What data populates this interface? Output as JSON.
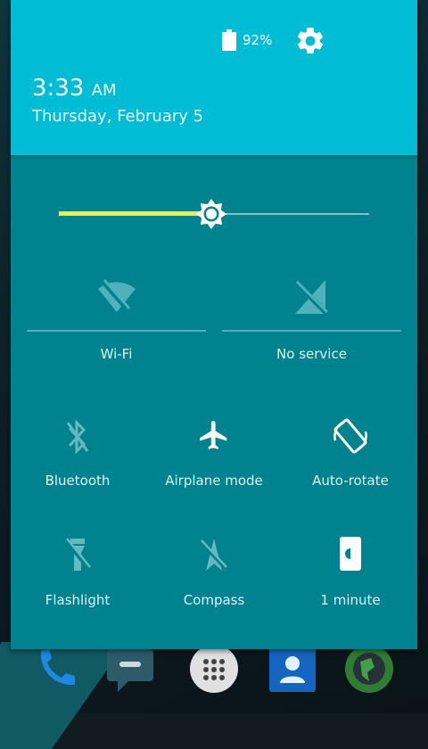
{
  "status": {
    "battery_percent": "92%",
    "battery_level": 0.92
  },
  "header": {
    "time": "3:33",
    "ampm": "AM",
    "date": "Thursday, February 5"
  },
  "brightness": {
    "level": 0.49
  },
  "tiles_top": [
    {
      "id": "wifi",
      "label": "Wi-Fi",
      "icon": "wifi-off-icon",
      "active": false
    },
    {
      "id": "cell",
      "label": "No service",
      "icon": "no-signal-icon",
      "active": false
    }
  ],
  "tiles_grid": [
    {
      "id": "bluetooth",
      "label": "Bluetooth",
      "icon": "bluetooth-off-icon",
      "active": false
    },
    {
      "id": "airplane",
      "label": "Airplane mode",
      "icon": "airplane-icon",
      "active": true
    },
    {
      "id": "autorotate",
      "label": "Auto-rotate",
      "icon": "auto-rotate-icon",
      "active": true
    },
    {
      "id": "flashlight",
      "label": "Flashlight",
      "icon": "flashlight-off-icon",
      "active": false
    },
    {
      "id": "compass",
      "label": "Compass",
      "icon": "compass-off-icon",
      "active": false
    },
    {
      "id": "screen-timeout",
      "label": "1 minute",
      "icon": "screen-timeout-icon",
      "active": true
    }
  ],
  "colors": {
    "header": "#00bcd4",
    "panel": "#00838f",
    "slider_fill": "#e6f05a",
    "icon_active": "#ffffff",
    "icon_inactive": "#66b9c1"
  },
  "dock": {
    "icons": [
      "phone-icon",
      "messaging-icon",
      "app-drawer-icon",
      "contacts-icon",
      "browser-icon"
    ]
  }
}
